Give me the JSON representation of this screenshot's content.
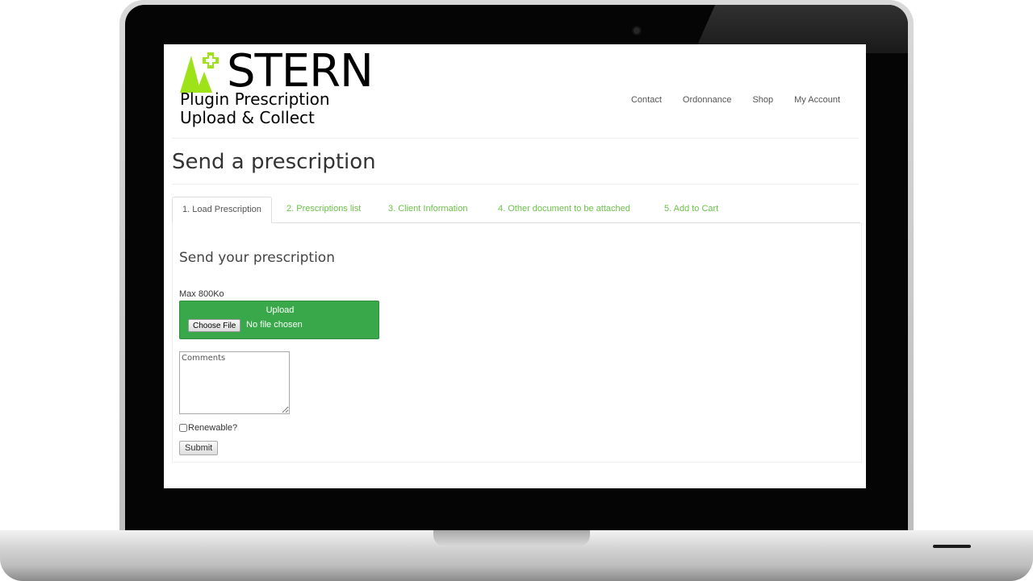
{
  "brand": {
    "wordmark": "STERN",
    "subtitle_line1": "Plugin Prescription",
    "subtitle_line2": "Upload & Collect",
    "accent_color": "#9ee31a"
  },
  "nav": {
    "items": [
      {
        "label": "Contact"
      },
      {
        "label": "Ordonnance"
      },
      {
        "label": "Shop"
      },
      {
        "label": "My Account"
      }
    ]
  },
  "page": {
    "title": "Send a prescription"
  },
  "tabs": [
    {
      "label": "1. Load Prescription",
      "active": true
    },
    {
      "label": "2. Prescriptions list",
      "active": false
    },
    {
      "label": "3. Client Information",
      "active": false
    },
    {
      "label": "4. Other document to be attached",
      "active": false
    },
    {
      "label": "5. Add to Cart",
      "active": false
    }
  ],
  "form": {
    "heading": "Send your prescription",
    "max_size_label": "Max 800Ko",
    "upload_label": "Upload",
    "choose_file_label": "Choose File",
    "file_status": "No file chosen",
    "comments_placeholder": "Comments",
    "comments_value": "",
    "renewable_label": "Renewable?",
    "renewable_checked": false,
    "submit_label": "Submit"
  },
  "colors": {
    "upload_green": "#38a84a",
    "tab_link_green": "#6cc04a",
    "text_dark": "#333333"
  }
}
